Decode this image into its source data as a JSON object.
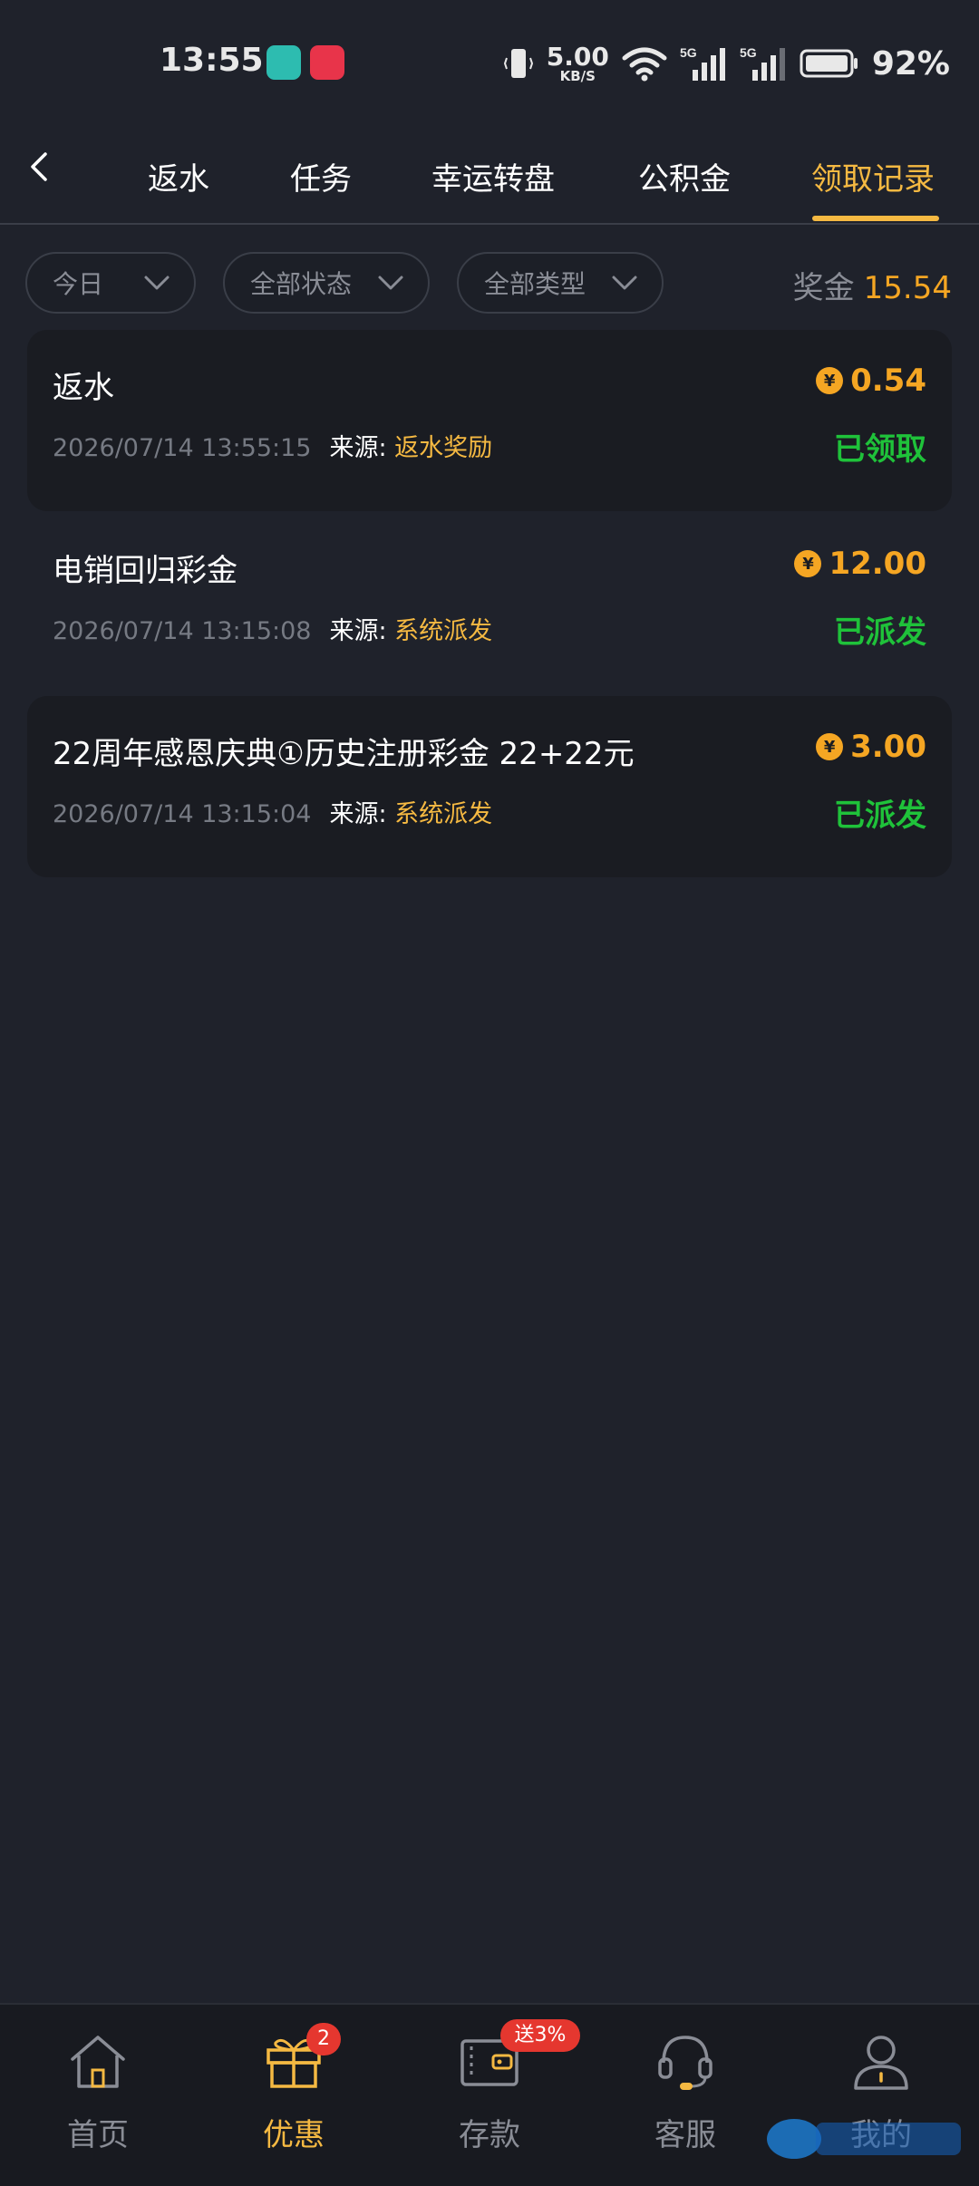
{
  "status_bar": {
    "time": "13:55",
    "net_speed_value": "5.00",
    "net_speed_unit": "KB/S",
    "battery_percent": "92%"
  },
  "header": {
    "tabs": [
      {
        "label": "返水"
      },
      {
        "label": "任务"
      },
      {
        "label": "幸运转盘"
      },
      {
        "label": "公积金"
      },
      {
        "label": "领取记录"
      }
    ],
    "active_tab": "领取记录"
  },
  "filters": {
    "date": "今日",
    "status": "全部状态",
    "type": "全部类型"
  },
  "summary": {
    "label": "奖金",
    "amount": "15.54"
  },
  "records": [
    {
      "title": "返水",
      "time": "2026/07/14 13:55:15",
      "source_label": "来源:",
      "source": "返水奖励",
      "amount": "0.54",
      "status": "已领取"
    },
    {
      "title": "电销回归彩金",
      "time": "2026/07/14 13:15:08",
      "source_label": "来源:",
      "source": "系统派发",
      "amount": "12.00",
      "status": "已派发"
    },
    {
      "title": "22周年感恩庆典①历史注册彩金 22+22元",
      "time": "2026/07/14 13:15:04",
      "source_label": "来源:",
      "source": "系统派发",
      "amount": "3.00",
      "status": "已派发"
    }
  ],
  "currency_symbol": "¥",
  "bottom_nav": {
    "items": [
      {
        "label": "首页",
        "icon": "home-icon"
      },
      {
        "label": "优惠",
        "icon": "gift-icon",
        "badge": "2"
      },
      {
        "label": "存款",
        "icon": "wallet-icon",
        "badge": "送3%"
      },
      {
        "label": "客服",
        "icon": "headset-icon"
      },
      {
        "label": "我的",
        "icon": "user-icon"
      }
    ],
    "active": "优惠"
  },
  "colors": {
    "background": "#1f222b",
    "accent": "#f5b942",
    "amount": "#f5a623",
    "success": "#1fc23a",
    "badge": "#e5372f"
  }
}
